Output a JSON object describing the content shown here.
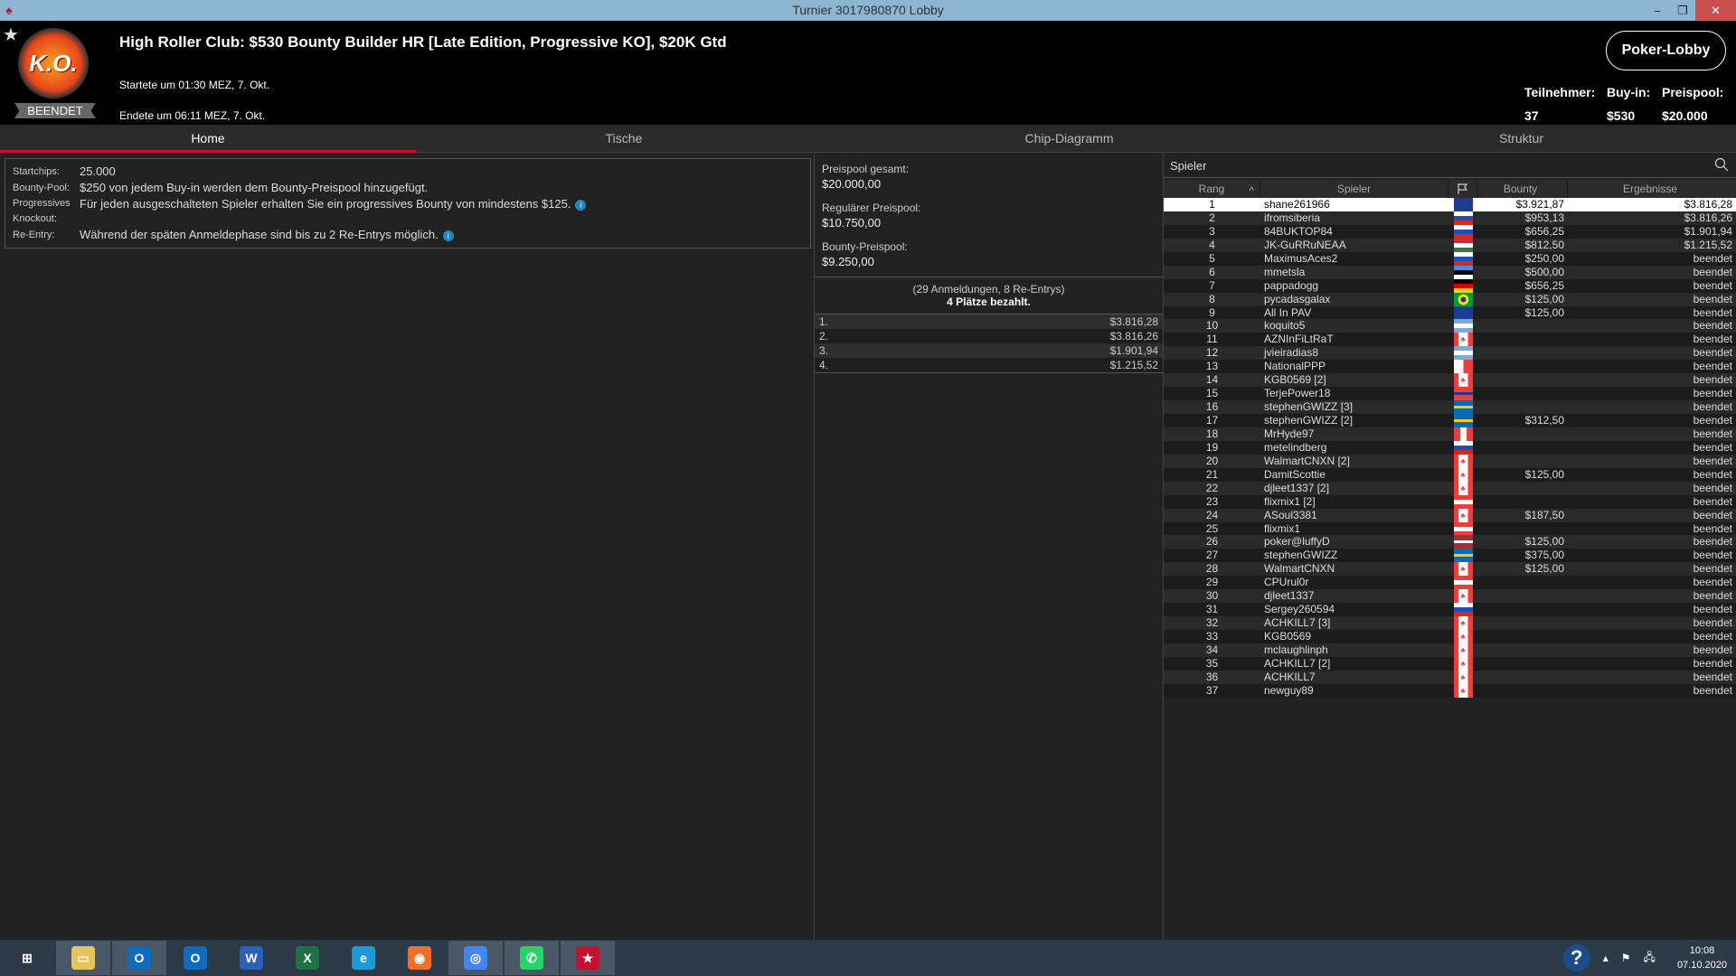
{
  "window": {
    "title": "Turnier 3017980870 Lobby",
    "minimize": "–",
    "restore": "❐",
    "close": "✕"
  },
  "header": {
    "logo_text": "K.O.",
    "status_badge": "BEENDET",
    "title": "High Roller Club: $530 Bounty Builder HR [Late Edition, Progressive KO], $20K Gtd",
    "started": "Startete um 01:30 MEZ, 7. Okt.",
    "ended": "Endete um 06:11 MEZ, 7. Okt.",
    "lobby_button": "Poker-Lobby",
    "stats": [
      {
        "label": "Teilnehmer:",
        "value": "37"
      },
      {
        "label": "Buy-in:",
        "value": "$530"
      },
      {
        "label": "Preispool:",
        "value": "$20.000"
      }
    ]
  },
  "tabs": [
    {
      "label": "Home",
      "active": true
    },
    {
      "label": "Tische"
    },
    {
      "label": "Chip-Diagramm"
    },
    {
      "label": "Struktur"
    }
  ],
  "info": [
    {
      "key": "Startchips:",
      "value": "25.000"
    },
    {
      "key": "Bounty-Pool:",
      "value": "$250 von jedem Buy-in werden dem Bounty-Preispool hinzugefügt."
    },
    {
      "key": "Progressives Knockout:",
      "value": "Für jeden ausgeschalteten Spieler erhalten Sie ein progressives Bounty von mindestens $125."
    },
    {
      "key": "Re-Entry:",
      "value": "Während der späten Anmeldephase sind bis zu 2 Re-Entrys möglich."
    }
  ],
  "info_icon": "i",
  "prize": {
    "pools": [
      {
        "label": "Preispool gesamt:",
        "value": "$20.000,00"
      },
      {
        "label": "Regulärer Preispool:",
        "value": "$10.750,00"
      },
      {
        "label": "Bounty-Preispool:",
        "value": "$9.250,00"
      }
    ],
    "registrations": "(29 Anmeldungen, 8 Re-Entrys)",
    "paid": "4 Plätze bezahlt.",
    "payouts": [
      {
        "place": "1.",
        "amount": "$3.816,28"
      },
      {
        "place": "2.",
        "amount": "$3.816,26"
      },
      {
        "place": "3.",
        "amount": "$1.901,94"
      },
      {
        "place": "4.",
        "amount": "$1.215,52"
      }
    ]
  },
  "players": {
    "search_placeholder": "Spieler",
    "columns": {
      "rank": "Rang",
      "sort": "^",
      "name": "Spieler",
      "bounty": "Bounty",
      "result": "Ergebnisse"
    },
    "rows": [
      {
        "rank": "1",
        "name": "shane261966",
        "flag": "au",
        "bounty": "$3.921,87",
        "result": "$3.816,28"
      },
      {
        "rank": "2",
        "name": "ifromsiberia",
        "flag": "ru",
        "bounty": "$953,13",
        "result": "$3.816,26"
      },
      {
        "rank": "3",
        "name": "84BUKTOP84",
        "flag": "ru",
        "bounty": "$656,25",
        "result": "$1.901,94"
      },
      {
        "rank": "4",
        "name": "JK-GuRRuNEAA",
        "flag": "hu",
        "bounty": "$812,50",
        "result": "$1.215,52"
      },
      {
        "rank": "5",
        "name": "MaximusAces2",
        "flag": "ru",
        "bounty": "$250,00",
        "result": "beendet"
      },
      {
        "rank": "6",
        "name": "mmetsla",
        "flag": "ee",
        "bounty": "$500,00",
        "result": "beendet"
      },
      {
        "rank": "7",
        "name": "pappadogg",
        "flag": "de",
        "bounty": "$656,25",
        "result": "beendet"
      },
      {
        "rank": "8",
        "name": "pycadasgalax",
        "flag": "br",
        "bounty": "$125,00",
        "result": "beendet"
      },
      {
        "rank": "9",
        "name": "All In PAV",
        "flag": "au",
        "bounty": "$125,00",
        "result": "beendet"
      },
      {
        "rank": "10",
        "name": "koquito5",
        "flag": "ar",
        "bounty": "",
        "result": "beendet"
      },
      {
        "rank": "11",
        "name": "AZNInFiLtRaT",
        "flag": "ca",
        "bounty": "",
        "result": "beendet"
      },
      {
        "rank": "12",
        "name": "jvieiradias8",
        "flag": "ar",
        "bounty": "",
        "result": "beendet"
      },
      {
        "rank": "13",
        "name": "NationalPPP",
        "flag": "mt",
        "bounty": "",
        "result": "beendet"
      },
      {
        "rank": "14",
        "name": "KGB0569 [2]",
        "flag": "ca",
        "bounty": "",
        "result": "beendet"
      },
      {
        "rank": "15",
        "name": "TerjePower18",
        "flag": "no",
        "bounty": "",
        "result": "beendet"
      },
      {
        "rank": "16",
        "name": "stephenGWIZZ [3]",
        "flag": "se",
        "bounty": "",
        "result": "beendet"
      },
      {
        "rank": "17",
        "name": "stephenGWIZZ [2]",
        "flag": "se",
        "bounty": "$312,50",
        "result": "beendet"
      },
      {
        "rank": "18",
        "name": "MrHyde97",
        "flag": "pe",
        "bounty": "",
        "result": "beendet"
      },
      {
        "rank": "19",
        "name": "metelindberg",
        "flag": "ru",
        "bounty": "",
        "result": "beendet"
      },
      {
        "rank": "20",
        "name": "WalmartCNXN [2]",
        "flag": "ca",
        "bounty": "",
        "result": "beendet"
      },
      {
        "rank": "21",
        "name": "DamitScottie",
        "flag": "ca",
        "bounty": "$125,00",
        "result": "beendet"
      },
      {
        "rank": "22",
        "name": "djleet1337 [2]",
        "flag": "ca",
        "bounty": "",
        "result": "beendet"
      },
      {
        "rank": "23",
        "name": "flixmix1 [2]",
        "flag": "at",
        "bounty": "",
        "result": "beendet"
      },
      {
        "rank": "24",
        "name": "ASoul3381",
        "flag": "ca",
        "bounty": "$187,50",
        "result": "beendet"
      },
      {
        "rank": "25",
        "name": "flixmix1",
        "flag": "at",
        "bounty": "",
        "result": "beendet"
      },
      {
        "rank": "26",
        "name": "poker@luffyD",
        "flag": "lv",
        "bounty": "$125,00",
        "result": "beendet"
      },
      {
        "rank": "27",
        "name": "stephenGWIZZ",
        "flag": "se",
        "bounty": "$375,00",
        "result": "beendet"
      },
      {
        "rank": "28",
        "name": "WalmartCNXN",
        "flag": "ca",
        "bounty": "$125,00",
        "result": "beendet"
      },
      {
        "rank": "29",
        "name": "CPUrul0r",
        "flag": "at",
        "bounty": "",
        "result": "beendet"
      },
      {
        "rank": "30",
        "name": "djleet1337",
        "flag": "ca",
        "bounty": "",
        "result": "beendet"
      },
      {
        "rank": "31",
        "name": "Sergey260594",
        "flag": "ru",
        "bounty": "",
        "result": "beendet"
      },
      {
        "rank": "32",
        "name": "ACHKILL7 [3]",
        "flag": "ca",
        "bounty": "",
        "result": "beendet"
      },
      {
        "rank": "33",
        "name": "KGB0569",
        "flag": "ca",
        "bounty": "",
        "result": "beendet"
      },
      {
        "rank": "34",
        "name": "mclaughlinph",
        "flag": "ca",
        "bounty": "",
        "result": "beendet"
      },
      {
        "rank": "35",
        "name": "ACHKILL7 [2]",
        "flag": "ca",
        "bounty": "",
        "result": "beendet"
      },
      {
        "rank": "36",
        "name": "ACHKILL7",
        "flag": "ca",
        "bounty": "",
        "result": "beendet"
      },
      {
        "rank": "37",
        "name": "newguy89",
        "flag": "ca",
        "bounty": "",
        "result": "beendet"
      }
    ]
  },
  "taskbar": {
    "apps": [
      {
        "name": "start",
        "glyph": "⊞",
        "color": "#2c3a48"
      },
      {
        "name": "file-explorer",
        "glyph": "▭",
        "color": "#e8c25a",
        "open": true
      },
      {
        "name": "outlook",
        "glyph": "O",
        "color": "#0f6cbd",
        "open": true
      },
      {
        "name": "outlook-2",
        "glyph": "O",
        "color": "#0f6cbd"
      },
      {
        "name": "word",
        "glyph": "W",
        "color": "#2b5fb9"
      },
      {
        "name": "excel",
        "glyph": "X",
        "color": "#1e7145"
      },
      {
        "name": "internet-explorer",
        "glyph": "e",
        "color": "#1a9bd7"
      },
      {
        "name": "firefox",
        "glyph": "◉",
        "color": "#f36f28"
      },
      {
        "name": "chrome",
        "glyph": "◎",
        "color": "#4285f4",
        "open": true
      },
      {
        "name": "whatsapp",
        "glyph": "✆",
        "color": "#25d366",
        "open": true
      },
      {
        "name": "pokerstars",
        "glyph": "★",
        "color": "#c8102e",
        "open": true
      }
    ],
    "tray": {
      "help": "?",
      "chevron": "▴",
      "flag": "⚑",
      "network": "🖧",
      "time": "10:08",
      "date": "07.10.2020"
    }
  },
  "colors": {
    "accent": "#c8102e",
    "titlebar": "#8eb5d1",
    "info_dot": "#1a8ac0"
  }
}
